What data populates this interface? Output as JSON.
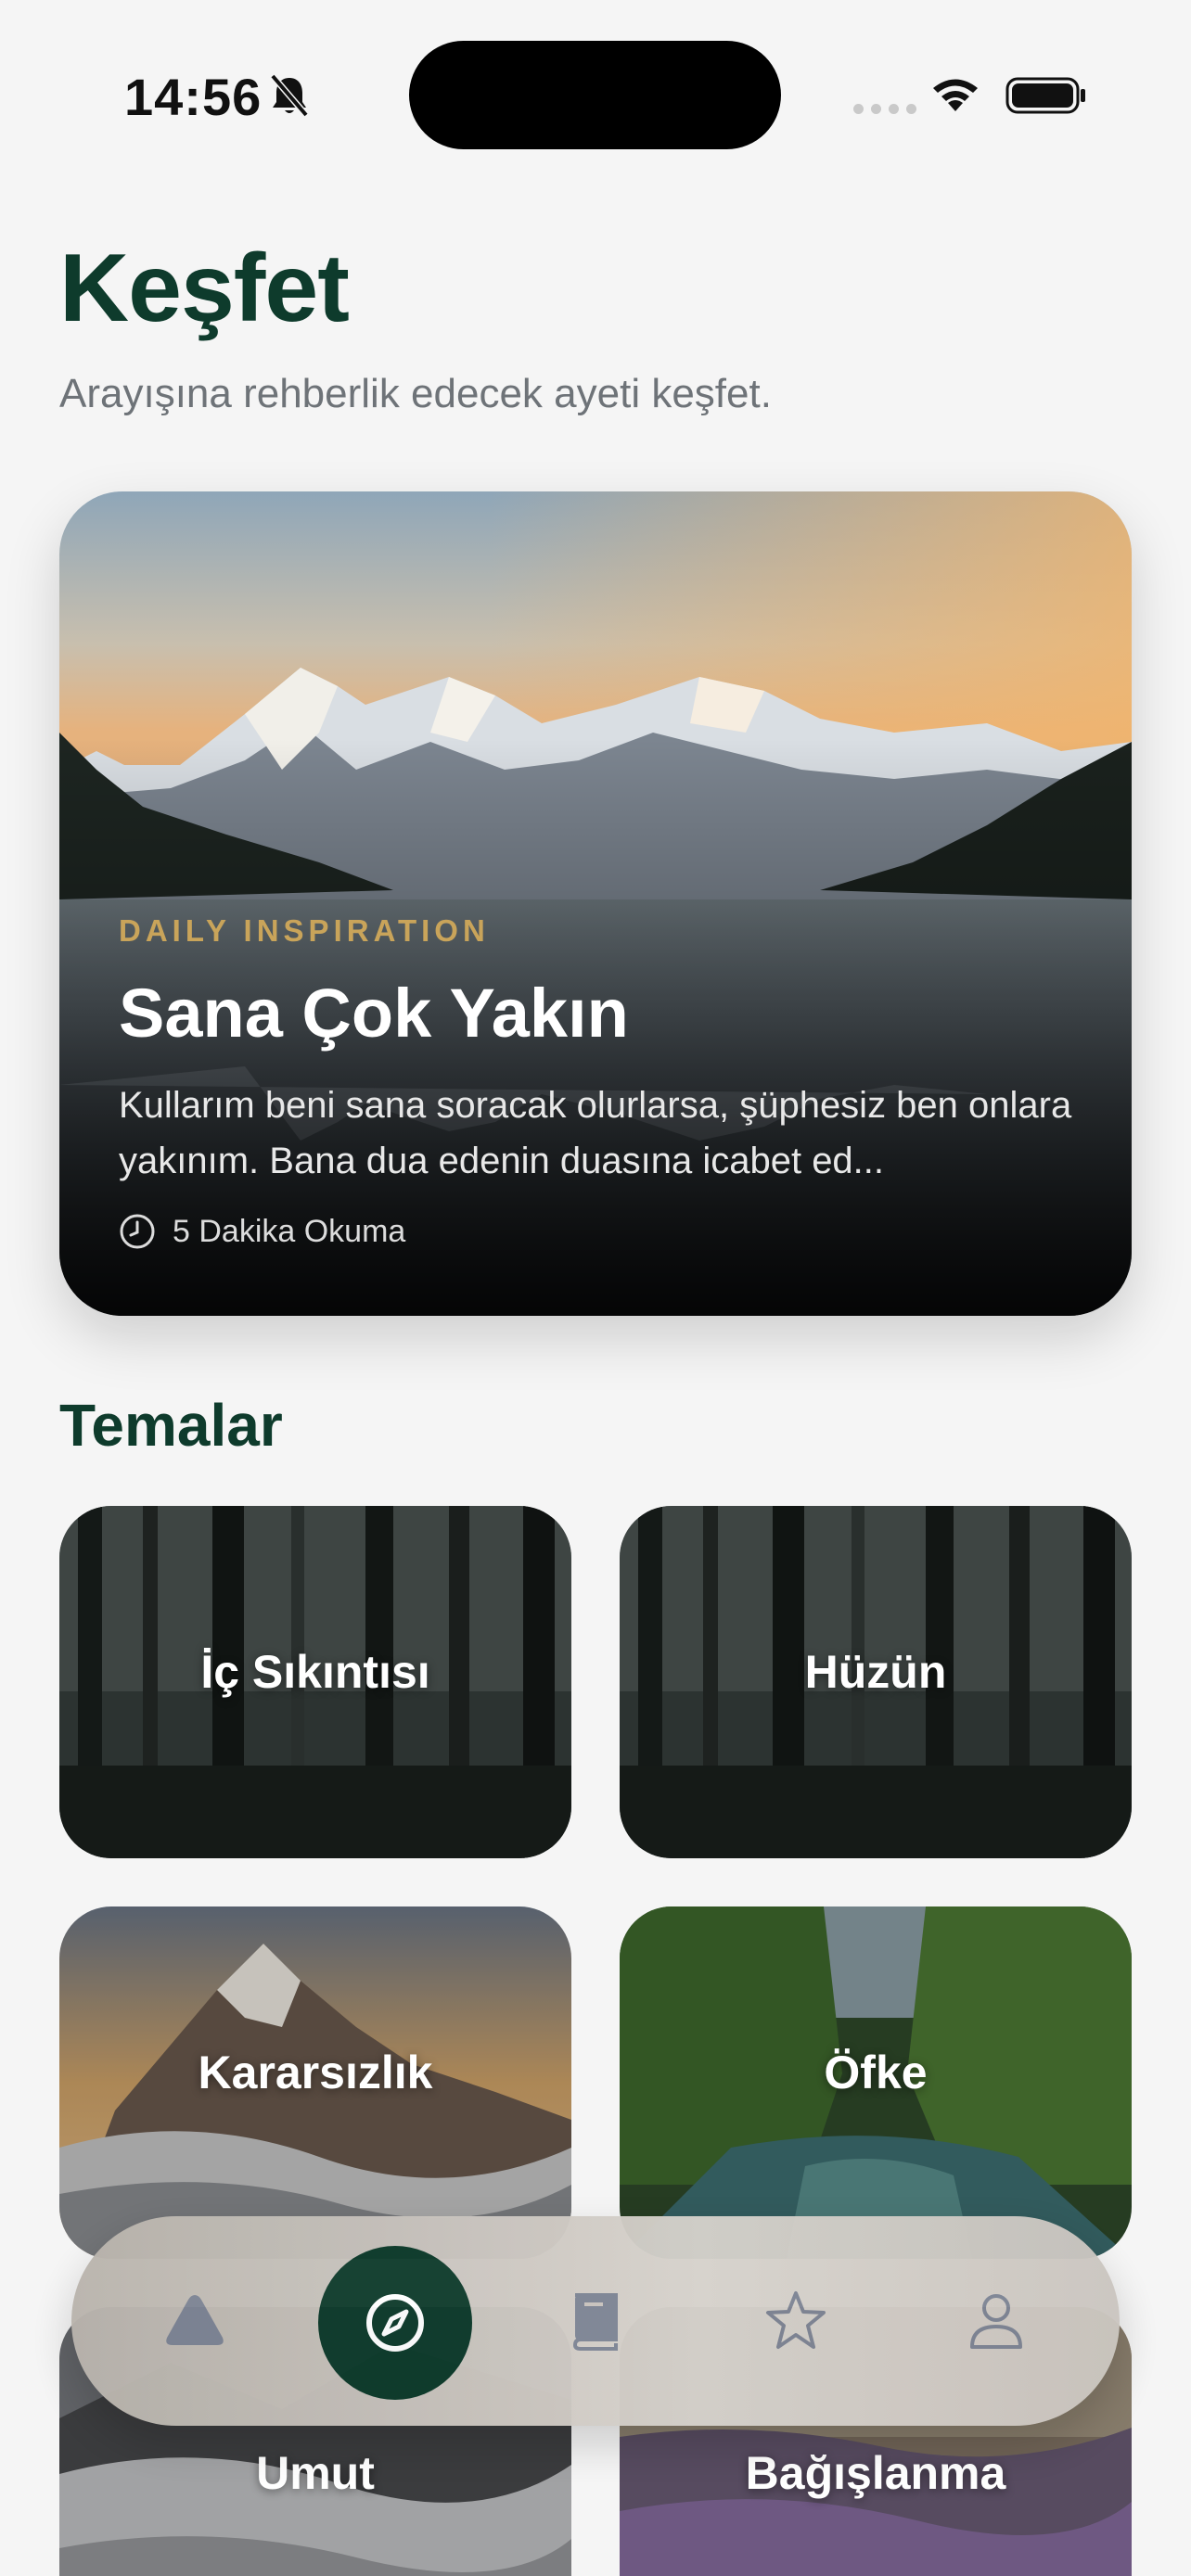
{
  "status_bar": {
    "time": "14:56",
    "icons": [
      "bell-slash-icon",
      "signal-icon",
      "wifi-icon",
      "battery-icon"
    ]
  },
  "header": {
    "title": "Keşfet",
    "subtitle": "Arayışına rehberlik edecek ayeti keşfet."
  },
  "hero": {
    "eyebrow": "DAILY INSPIRATION",
    "title": "Sana Çok Yakın",
    "description": "Kullarım beni sana soracak olurlarsa, şüphesiz ben onlara yakınım. Bana dua edenin duasına icabet ed...",
    "read_time": "5 Dakika Okuma",
    "image": "mountain-lake-sunset"
  },
  "themes": {
    "title": "Temalar",
    "items": [
      {
        "label": "İç Sıkıntısı",
        "image": "misty-forest"
      },
      {
        "label": "Hüzün",
        "image": "misty-forest"
      },
      {
        "label": "Kararsızlık",
        "image": "mountain-peak-clouds"
      },
      {
        "label": "Öfke",
        "image": "green-canyon-river"
      },
      {
        "label": "Umut",
        "image": "mountain-clouds"
      },
      {
        "label": "Bağışlanma",
        "image": "lavender-field"
      }
    ]
  },
  "tabbar": {
    "active": "discover",
    "items": [
      {
        "name": "home",
        "icon": "triangle-icon"
      },
      {
        "name": "discover",
        "icon": "compass-icon"
      },
      {
        "name": "library",
        "icon": "book-icon"
      },
      {
        "name": "favorites",
        "icon": "star-icon"
      },
      {
        "name": "profile",
        "icon": "person-icon"
      }
    ]
  },
  "colors": {
    "brand_green": "#0e3b2c",
    "eyebrow_gold": "#c9a45a",
    "background": "#f5f5f5",
    "subtitle_gray": "#6e7378"
  }
}
